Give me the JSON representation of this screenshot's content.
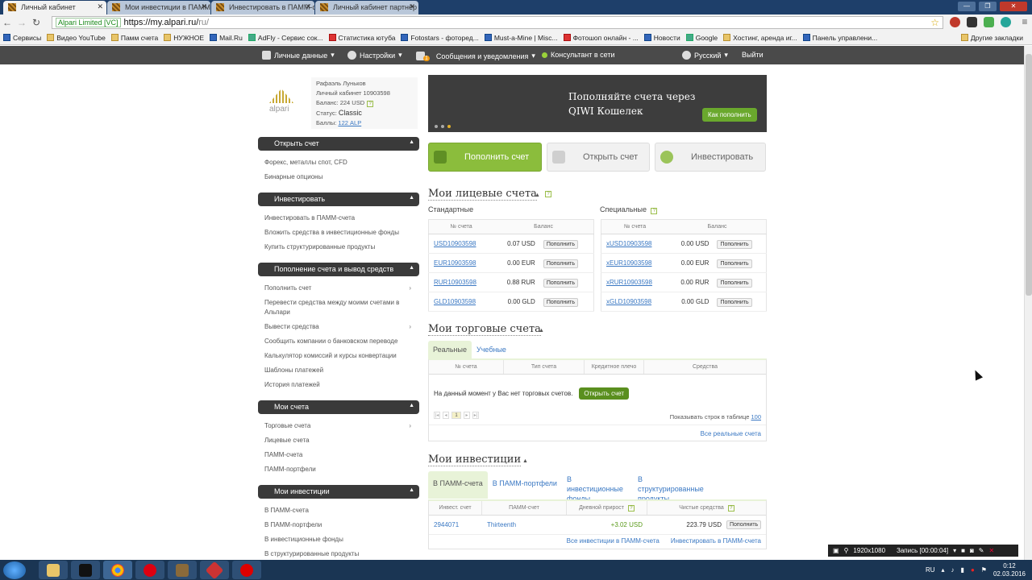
{
  "browser": {
    "tabs": [
      {
        "title": "Личный кабинет",
        "active": true
      },
      {
        "title": "Мои инвестиции в ПАММ",
        "active": false
      },
      {
        "title": "Инвестировать в ПАММ-с",
        "active": false
      },
      {
        "title": "Личный кабинет партнёр",
        "active": false
      }
    ],
    "secure_label": "Alpari Limited [VC]",
    "url_host": "https://my.alpari.ru/",
    "url_path": "ru/",
    "bookmarks": [
      "Сервисы",
      "Видео YouTube",
      "Памм счета",
      "НУЖНОЕ",
      "Mail.Ru",
      "AdFly - Сервис сок...",
      "Статистика ютуба",
      "Fotostars - фоторед...",
      "Must-a-Mine | Misc...",
      "Фотошоп онлайн - ...",
      "Новости",
      "Google",
      "Хостинг, аренда иг...",
      "Панель управлени..."
    ],
    "other_bookmarks": "Другие закладки"
  },
  "topnav": {
    "personal": "Личные данные",
    "settings": "Настройки",
    "messages": "Сообщения и уведомления",
    "messages_badge": "1",
    "consultant": "Консультант в сети",
    "language": "Русский",
    "logout": "Выйти"
  },
  "profile": {
    "logo_text": "alpari",
    "name": "Рафаэль Луньков",
    "cabinet": "Личный кабинет 10903598",
    "balance": "Баланс: 224 USD",
    "status_label": "Статус:",
    "status": "Classic",
    "points_label": "Баллы:",
    "points": "122 ALP"
  },
  "sidebar": {
    "sections": [
      {
        "title": "Открыть счет",
        "links": [
          "Форекс, металлы спот, CFD",
          "Бинарные опционы"
        ]
      },
      {
        "title": "Инвестировать",
        "links": [
          "Инвестировать в ПАММ-счета",
          "Вложить средства в инвестиционные фонды",
          "Купить структурированные продукты"
        ]
      },
      {
        "title": "Пополнение счета и вывод средств",
        "links": [
          "Пополнить счет",
          "Перевести средства между моими счетами в Альпари",
          "Вывести средства",
          "Сообщить компании о банковском переводе",
          "Калькулятор комиссий и курсы конвертации",
          "Шаблоны платежей",
          "История платежей"
        ]
      },
      {
        "title": "Мои счета",
        "links": [
          "Торговые счета",
          "Лицевые счета",
          "ПАММ-счета",
          "ПАММ-портфели"
        ]
      },
      {
        "title": "Мои инвестиции",
        "links": [
          "В ПАММ-счета",
          "В ПАММ-портфели",
          "В инвестиционные фонды",
          "В структурированные продукты"
        ]
      }
    ]
  },
  "banner": {
    "line1": "Пополняйте счета через",
    "line2": "QIWI Кошелек",
    "button": "Как пополнить"
  },
  "actions": {
    "deposit": "Пополнить счет",
    "open": "Открыть счет",
    "invest": "Инвестировать"
  },
  "personal_accounts": {
    "title": "Мои лицевые счета",
    "standard_label": "Стандартные",
    "special_label": "Специальные",
    "col_num": "№ счета",
    "col_balance": "Баланс",
    "topup": "Пополнить",
    "standard": [
      {
        "num": "USD10903598",
        "balance": "0.07 USD"
      },
      {
        "num": "EUR10903598",
        "balance": "0.00 EUR"
      },
      {
        "num": "RUR10903598",
        "balance": "0.88 RUR"
      },
      {
        "num": "GLD10903598",
        "balance": "0.00 GLD"
      }
    ],
    "special": [
      {
        "num": "xUSD10903598",
        "balance": "0.00 USD"
      },
      {
        "num": "xEUR10903598",
        "balance": "0.00 EUR"
      },
      {
        "num": "xRUR10903598",
        "balance": "0.00 RUR"
      },
      {
        "num": "xGLD10903598",
        "balance": "0.00 GLD"
      }
    ]
  },
  "trading_accounts": {
    "title": "Мои торговые счета",
    "tab_real": "Реальные",
    "tab_demo": "Учебные",
    "cols": [
      "№ счета",
      "Тип счета",
      "Кредитное плечо",
      "Средства"
    ],
    "empty": "На данный момент у Вас нет торговых счетов.",
    "open_button": "Открыть счет",
    "page": "1",
    "rows_label": "Показывать строк в таблице",
    "rows_value": "100",
    "all_link": "Все реальные счета"
  },
  "investments": {
    "title": "Мои инвестиции",
    "tabs": [
      "В ПАММ-счета",
      "В ПАММ-портфели",
      "В инвестиционные фонды",
      "В структурированные продукты"
    ],
    "cols": [
      "Инвест. счет",
      "ПАММ-счет",
      "Дневной прирост",
      "Чистые средства"
    ],
    "row": {
      "account": "2944071",
      "pamm": "Thirteenth",
      "daily": "+3.02 USD",
      "net": "223.79 USD"
    },
    "topup": "Пополнить",
    "link_all": "Все инвестиции в ПАММ-счета",
    "link_invest": "Инвестировать в ПАММ-счета"
  },
  "recorder": {
    "res": "1920x1080",
    "label": "Запись [00:00:04]"
  },
  "taskbar": {
    "lang": "RU",
    "time": "0:12",
    "date": "02.03.2016"
  }
}
